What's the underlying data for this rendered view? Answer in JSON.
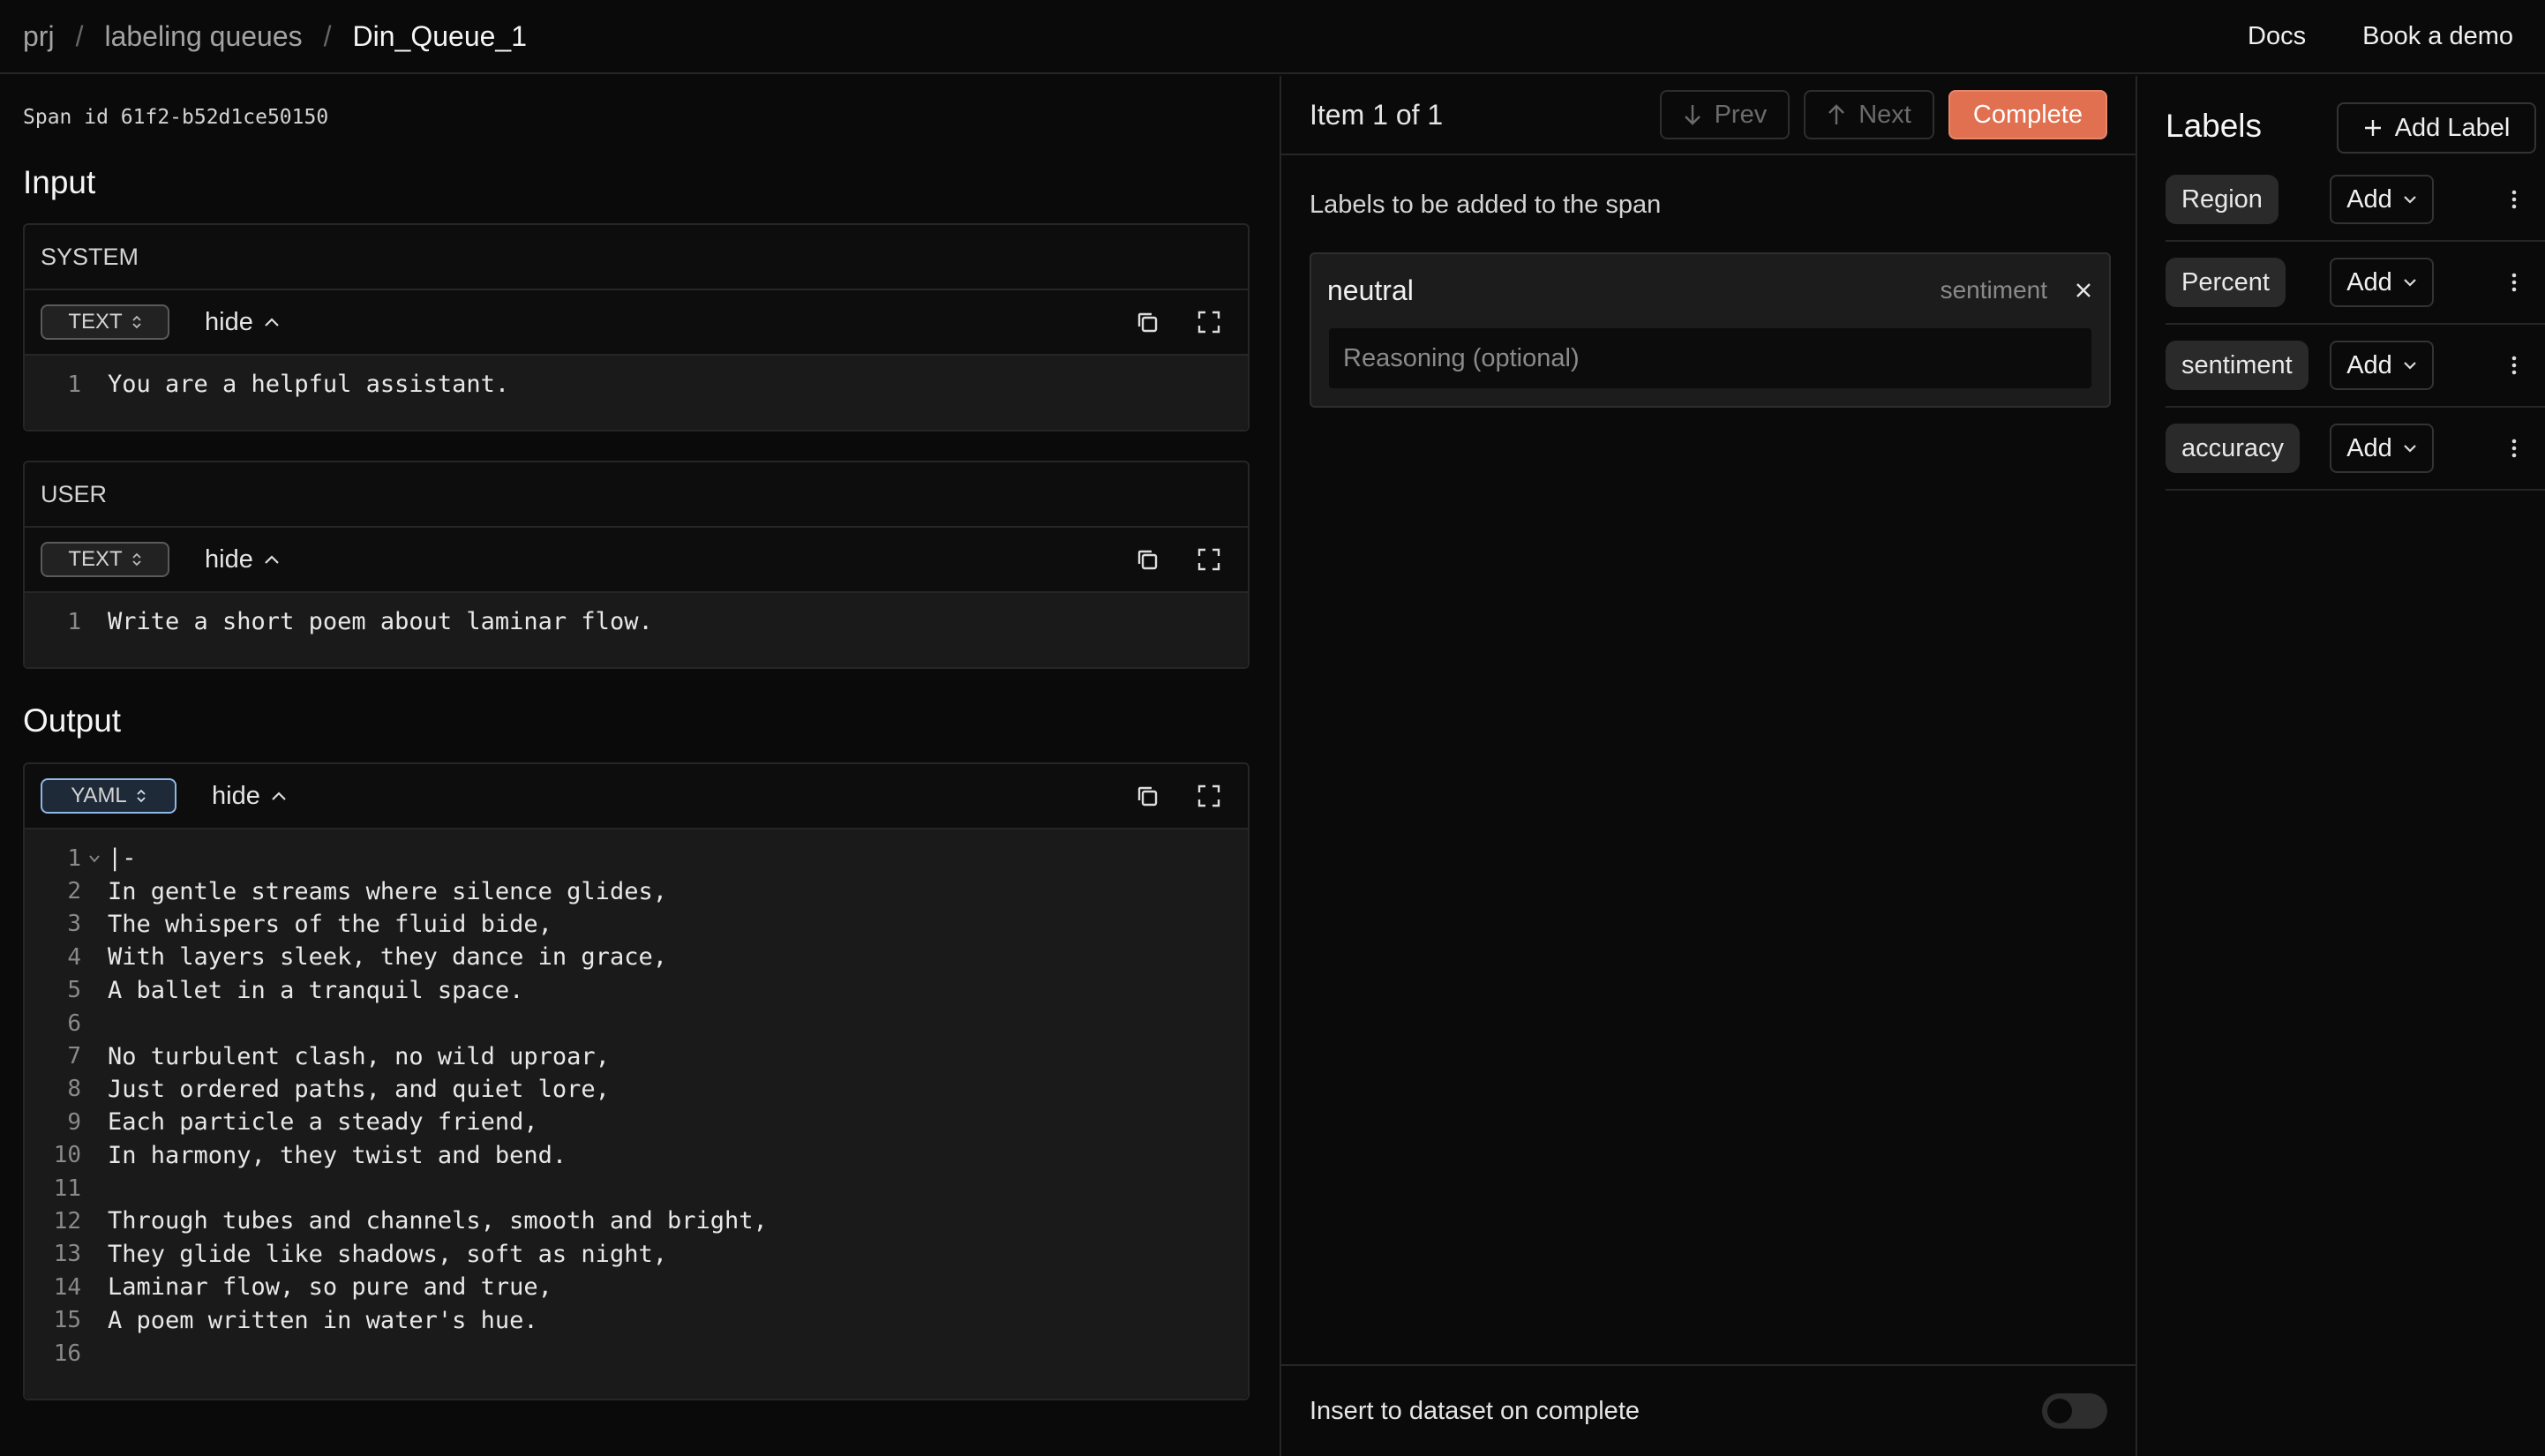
{
  "breadcrumb": {
    "project": "prj",
    "section": "labeling queues",
    "queue": "Din_Queue_1",
    "separator": "/"
  },
  "header": {
    "docs": "Docs",
    "demo": "Book a demo"
  },
  "span": {
    "id_text": "Span id 61f2-b52d1ce50150"
  },
  "input": {
    "title": "Input",
    "messages": [
      {
        "role": "SYSTEM",
        "format": "TEXT",
        "toggle_label": "hide",
        "lines": [
          {
            "num": "1",
            "text": "You are a helpful assistant."
          }
        ]
      },
      {
        "role": "USER",
        "format": "TEXT",
        "toggle_label": "hide",
        "lines": [
          {
            "num": "1",
            "text": "Write a short poem about laminar flow."
          }
        ]
      }
    ]
  },
  "output": {
    "title": "Output",
    "format": "YAML",
    "toggle_label": "hide",
    "lines": [
      {
        "num": "1",
        "text": "|-"
      },
      {
        "num": "2",
        "text": "In gentle streams where silence glides,"
      },
      {
        "num": "3",
        "text": "The whispers of the fluid bide,"
      },
      {
        "num": "4",
        "text": "With layers sleek, they dance in grace,"
      },
      {
        "num": "5",
        "text": "A ballet in a tranquil space."
      },
      {
        "num": "6",
        "text": ""
      },
      {
        "num": "7",
        "text": "No turbulent clash, no wild uproar,"
      },
      {
        "num": "8",
        "text": "Just ordered paths, and quiet lore,"
      },
      {
        "num": "9",
        "text": "Each particle a steady friend,"
      },
      {
        "num": "10",
        "text": "In harmony, they twist and bend."
      },
      {
        "num": "11",
        "text": ""
      },
      {
        "num": "12",
        "text": "Through tubes and channels, smooth and bright,"
      },
      {
        "num": "13",
        "text": "They glide like shadows, soft as night,"
      },
      {
        "num": "14",
        "text": "Laminar flow, so pure and true,"
      },
      {
        "num": "15",
        "text": "A poem written in water's hue."
      },
      {
        "num": "16",
        "text": ""
      }
    ]
  },
  "queue_nav": {
    "item_count": "Item 1 of 1",
    "prev": "Prev",
    "next": "Next",
    "complete": "Complete"
  },
  "pending_labels": {
    "caption": "Labels to be added to the span",
    "items": [
      {
        "label": "neutral",
        "type": "sentiment",
        "reasoning_placeholder": "Reasoning (optional)"
      }
    ]
  },
  "footer": {
    "insert_text": "Insert to dataset on complete",
    "insert_enabled": false
  },
  "labels_panel": {
    "title": "Labels",
    "add_label": "Add Label",
    "add_button": "Add",
    "items": [
      {
        "name": "Region"
      },
      {
        "name": "Percent"
      },
      {
        "name": "sentiment"
      },
      {
        "name": "accuracy"
      }
    ]
  },
  "colors": {
    "accent": "#e07050",
    "background": "#0a0a0a",
    "active_format": "#8fb6e6"
  }
}
